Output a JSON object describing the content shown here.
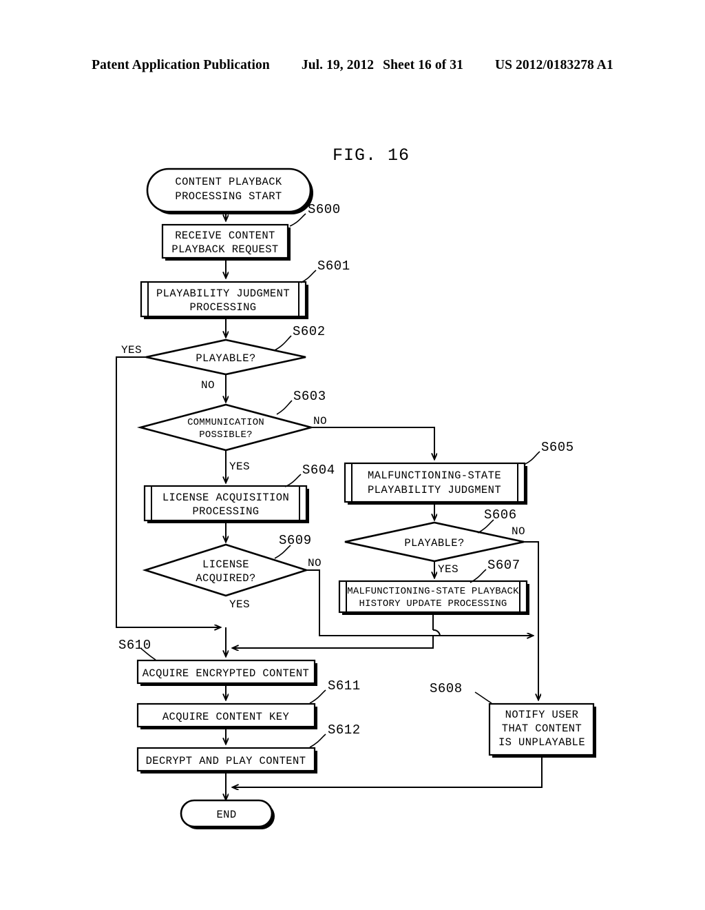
{
  "patent_header": {
    "publication": "Patent Application Publication",
    "date": "Jul. 19, 2012",
    "sheet": "Sheet 16 of 31",
    "number": "US 2012/0183278 A1"
  },
  "figure": {
    "title": "FIG. 16"
  },
  "chart_data": {
    "type": "diagram",
    "diagram_kind": "flowchart",
    "title": "FIG. 16",
    "nodes": [
      {
        "id": "start",
        "shape": "terminator",
        "step": null,
        "lines": [
          "CONTENT PLAYBACK",
          "PROCESSING START"
        ]
      },
      {
        "id": "s600",
        "shape": "process",
        "step": "S600",
        "lines": [
          "RECEIVE CONTENT",
          "PLAYBACK REQUEST"
        ]
      },
      {
        "id": "s601",
        "shape": "predefined-process",
        "step": "S601",
        "lines": [
          "PLAYABILITY JUDGMENT",
          "PROCESSING"
        ]
      },
      {
        "id": "s602",
        "shape": "decision",
        "step": "S602",
        "lines": [
          "PLAYABLE?"
        ]
      },
      {
        "id": "s603",
        "shape": "decision",
        "step": "S603",
        "lines": [
          "COMMUNICATION",
          "POSSIBLE?"
        ]
      },
      {
        "id": "s604",
        "shape": "predefined-process",
        "step": "S604",
        "lines": [
          "LICENSE ACQUISITION",
          "PROCESSING"
        ]
      },
      {
        "id": "s605",
        "shape": "predefined-process",
        "step": "S605",
        "lines": [
          "MALFUNCTIONING-STATE",
          "PLAYABILITY JUDGMENT"
        ]
      },
      {
        "id": "s606",
        "shape": "decision",
        "step": "S606",
        "lines": [
          "PLAYABLE?"
        ]
      },
      {
        "id": "s607",
        "shape": "predefined-process",
        "step": "S607",
        "lines": [
          "MALFUNCTIONING-STATE PLAYBACK",
          "HISTORY UPDATE PROCESSING"
        ]
      },
      {
        "id": "s608",
        "shape": "process",
        "step": "S608",
        "lines": [
          "NOTIFY USER",
          "THAT CONTENT",
          "IS UNPLAYABLE"
        ]
      },
      {
        "id": "s609",
        "shape": "decision",
        "step": "S609",
        "lines": [
          "LICENSE",
          "ACQUIRED?"
        ]
      },
      {
        "id": "s610",
        "shape": "process",
        "step": "S610",
        "lines": [
          "ACQUIRE ENCRYPTED CONTENT"
        ]
      },
      {
        "id": "s611",
        "shape": "process",
        "step": "S611",
        "lines": [
          "ACQUIRE CONTENT KEY"
        ]
      },
      {
        "id": "s612",
        "shape": "process",
        "step": "S612",
        "lines": [
          "DECRYPT AND PLAY CONTENT"
        ]
      },
      {
        "id": "end",
        "shape": "terminator",
        "step": null,
        "lines": [
          "END"
        ]
      }
    ],
    "edges": [
      {
        "from": "start",
        "to": "s600",
        "label": ""
      },
      {
        "from": "s600",
        "to": "s601",
        "label": ""
      },
      {
        "from": "s601",
        "to": "s602",
        "label": ""
      },
      {
        "from": "s602",
        "to": "s610",
        "label": "YES"
      },
      {
        "from": "s602",
        "to": "s603",
        "label": "NO"
      },
      {
        "from": "s603",
        "to": "s605",
        "label": "NO"
      },
      {
        "from": "s603",
        "to": "s604",
        "label": "YES"
      },
      {
        "from": "s604",
        "to": "s609",
        "label": ""
      },
      {
        "from": "s605",
        "to": "s606",
        "label": ""
      },
      {
        "from": "s606",
        "to": "s608",
        "label": "NO"
      },
      {
        "from": "s606",
        "to": "s607",
        "label": "YES"
      },
      {
        "from": "s607",
        "to": "s610",
        "label": ""
      },
      {
        "from": "s609",
        "to": "s610",
        "label": "YES"
      },
      {
        "from": "s609",
        "to": "s608",
        "label": "NO"
      },
      {
        "from": "s610",
        "to": "s611",
        "label": ""
      },
      {
        "from": "s611",
        "to": "s612",
        "label": ""
      },
      {
        "from": "s612",
        "to": "end",
        "label": ""
      },
      {
        "from": "s608",
        "to": "end",
        "label": ""
      }
    ],
    "step_labels": [
      "S600",
      "S601",
      "S602",
      "S603",
      "S604",
      "S605",
      "S606",
      "S607",
      "S608",
      "S609",
      "S610",
      "S611",
      "S612"
    ],
    "branch_labels": [
      "YES",
      "NO"
    ]
  },
  "nodes": {
    "start": {
      "l1": "CONTENT PLAYBACK",
      "l2": "PROCESSING START"
    },
    "s600": {
      "l1": "RECEIVE CONTENT",
      "l2": "PLAYBACK REQUEST",
      "step": "S600"
    },
    "s601": {
      "l1": "PLAYABILITY JUDGMENT",
      "l2": "PROCESSING",
      "step": "S601"
    },
    "s602": {
      "l1": "PLAYABLE?",
      "step": "S602"
    },
    "s603": {
      "l1": "COMMUNICATION",
      "l2": "POSSIBLE?",
      "step": "S603"
    },
    "s604": {
      "l1": "LICENSE ACQUISITION",
      "l2": "PROCESSING",
      "step": "S604"
    },
    "s605": {
      "l1": "MALFUNCTIONING-STATE",
      "l2": "PLAYABILITY JUDGMENT",
      "step": "S605"
    },
    "s606": {
      "l1": "PLAYABLE?",
      "step": "S606"
    },
    "s607": {
      "l1": "MALFUNCTIONING-STATE PLAYBACK",
      "l2": "HISTORY UPDATE PROCESSING",
      "step": "S607"
    },
    "s608": {
      "l1": "NOTIFY USER",
      "l2": "THAT CONTENT",
      "l3": "IS UNPLAYABLE",
      "step": "S608"
    },
    "s609": {
      "l1": "LICENSE",
      "l2": "ACQUIRED?",
      "step": "S609"
    },
    "s610": {
      "l1": "ACQUIRE ENCRYPTED CONTENT",
      "step": "S610"
    },
    "s611": {
      "l1": "ACQUIRE CONTENT KEY",
      "step": "S611"
    },
    "s612": {
      "l1": "DECRYPT AND PLAY CONTENT",
      "step": "S612"
    },
    "end": {
      "l1": "END"
    }
  },
  "branches": {
    "s602_yes": "YES",
    "s602_no": "NO",
    "s603_no": "NO",
    "s603_yes": "YES",
    "s606_no": "NO",
    "s606_yes": "YES",
    "s609_no": "NO",
    "s609_yes": "YES"
  }
}
